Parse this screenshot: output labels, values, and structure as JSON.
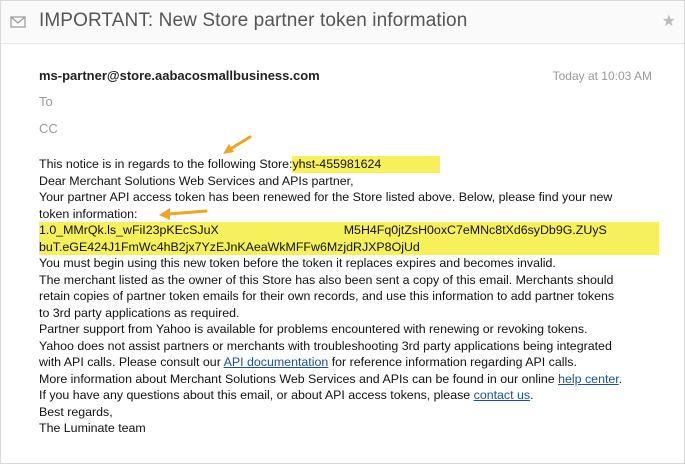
{
  "email": {
    "subject": "IMPORTANT: New Store partner token information",
    "from": "ms-partner@store.aabacosmallbusiness.com",
    "to_label": "To",
    "cc_label": "CC",
    "date": "Today at 10:03 AM"
  },
  "icons": {
    "envelope": "envelope-icon",
    "star": "star-icon",
    "arrow": "arrow-annotation-icon"
  },
  "body": {
    "line1_text": "This notice is in regards to the following Store:",
    "store_id": "yhst-455981624",
    "line2": "Dear Merchant Solutions Web Services and APIs partner,",
    "line3": "Your partner API access token has been renewed for the Store listed above. Below, please find your new",
    "line4": "token information:",
    "token_line1": "1.0_MMrQk.ls_wFiI23pKEcSJuX",
    "token_line1_end": "M5H4Fq0jtZsH0oxC7eMNc8tXd6syDb9G.ZUyS",
    "token_line2": "buT.eGE424J1FmWc4hB2jx7YzEJnKAeaWkMFFw6MzjdRJXP8OjUd",
    "line5": "You must begin using this new token before the token it replaces expires and becomes invalid.",
    "line6": "The merchant listed as the owner of this Store has also been sent a copy of this email. Merchants should",
    "line7": "retain copies of partner token emails for their own records, and use this information to add partner tokens",
    "line8": "to 3rd party applications as required.",
    "line9": "Partner support from Yahoo is available for problems encountered with renewing or revoking tokens.",
    "line10": "Yahoo does not assist partners or merchants with troubleshooting 3rd party applications being integrated",
    "line11a": "with API calls. Please consult our ",
    "api_doc_link": "API documentation",
    "line11b": " for reference information regarding API calls.",
    "line12a": "More information about Merchant Solutions Web Services and APIs can be found in our online ",
    "help_link": "help center",
    "line12b": ".",
    "line13a": "If you have any questions about this email, or about API access tokens, please ",
    "contact_link": "contact us",
    "line13b": ".",
    "line14": "Best regards,",
    "line15": "The Luminate team"
  },
  "colors": {
    "highlight": "#f6f05a",
    "arrow": "#f0a41f",
    "link": "#1a4f9c"
  }
}
